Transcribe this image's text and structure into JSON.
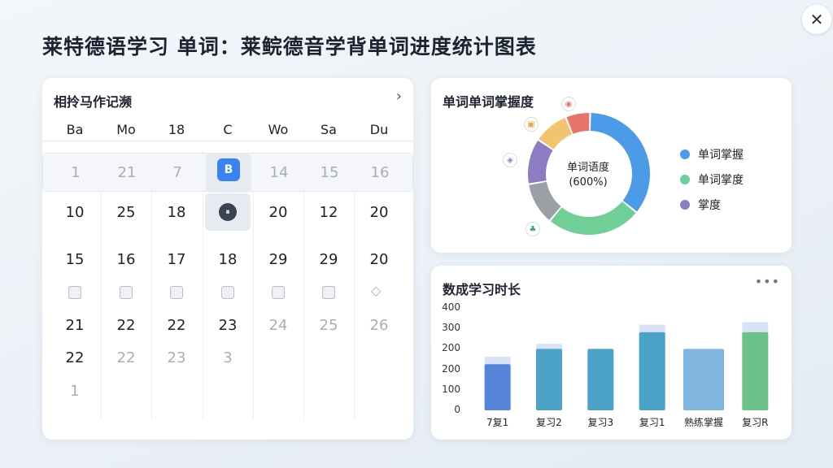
{
  "page": {
    "title": "莱特德语学习 单词：莱鲩德音学背单词进度统计图表",
    "close_label": "✕"
  },
  "calendar": {
    "title": "相拎马作记濒",
    "nav_icon": "chevron-right-icon",
    "weekdays": [
      "Ba",
      "Mo",
      "18",
      "C",
      "Wo",
      "Sa",
      "Du"
    ],
    "rows": [
      [
        "1",
        "21",
        "7",
        "",
        "14",
        "15",
        "16"
      ],
      [
        "10",
        "25",
        "18",
        "",
        "20",
        "12",
        "20"
      ],
      [
        "15",
        "16",
        "17",
        "18",
        "29",
        "29",
        "20"
      ],
      [
        "",
        "",
        "",
        "",
        "",
        "",
        ""
      ],
      [
        "21",
        "22",
        "22",
        "23",
        "24",
        "25",
        "26"
      ],
      [
        "22",
        "22",
        "23",
        "3",
        "",
        "",
        ""
      ],
      [
        "1",
        "",
        "",
        "",
        "",
        "",
        ""
      ]
    ],
    "today_glyph": "B",
    "selected_glyph": "⏸"
  },
  "donut": {
    "title": "单词单词掌握度",
    "center_line1": "单词语度",
    "center_line2": "(600%)",
    "legend": [
      {
        "label": "单词掌握",
        "color": "#4c9be8"
      },
      {
        "label": "单词掌度",
        "color": "#6fcf97"
      },
      {
        "label": "掌度",
        "color": "#8e7cc3"
      }
    ],
    "segments": [
      {
        "value": 38,
        "color": "#4c9be8"
      },
      {
        "value": 27,
        "color": "#6fcf97"
      },
      {
        "value": 12,
        "color": "#9aa0a6"
      },
      {
        "value": 13,
        "color": "#8e7cc3"
      },
      {
        "value": 10,
        "color": "#f2c46d"
      },
      {
        "value": 7,
        "color": "#e8736b"
      }
    ]
  },
  "chart_data": {
    "type": "bar",
    "title": "数成学习时长",
    "yticks": [
      "400",
      "300",
      "200",
      "200",
      "100",
      "0"
    ],
    "ylim": [
      0,
      400
    ],
    "categories": [
      "7复1",
      "复习2",
      "复习3",
      "复习1",
      "熟练掌握",
      "复习R"
    ],
    "series": [
      {
        "values": [
          210,
          260,
          215,
          335,
          215,
          345
        ],
        "color": "#c8d7f2"
      },
      {
        "values": [
          180,
          240,
          240,
          305,
          240,
          305
        ],
        "color": "#4e88d9"
      }
    ],
    "bar_colors": [
      "#5584d8",
      "#4ba3c7",
      "#4ba3c7",
      "#4ba3c7",
      "#7fb5df",
      "#6cc28a"
    ]
  }
}
